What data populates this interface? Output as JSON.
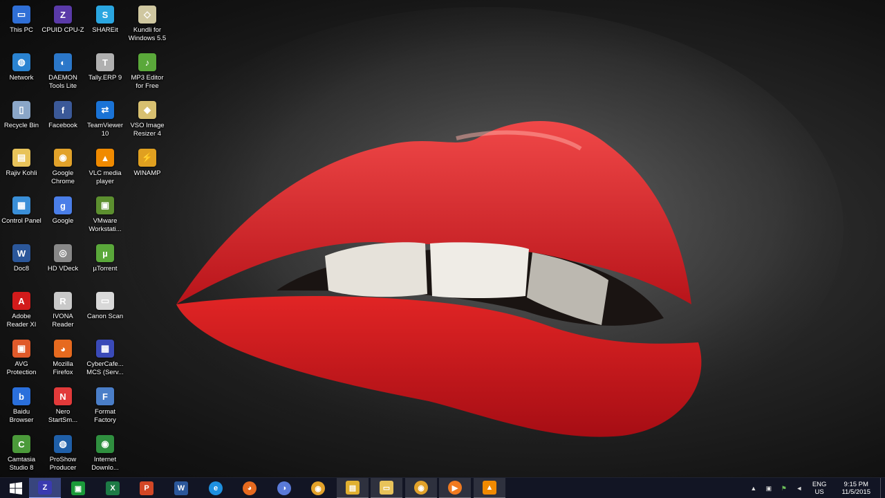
{
  "desktop": {
    "icons": [
      {
        "label": "This PC",
        "icon": "computer-icon",
        "color": "#2f6fd6",
        "glyph": "▭"
      },
      {
        "label": "Network",
        "icon": "network-globe-icon",
        "color": "#2a83d1",
        "glyph": "◍"
      },
      {
        "label": "Recycle Bin",
        "icon": "recycle-bin-icon",
        "color": "#8aa6c8",
        "glyph": "▯"
      },
      {
        "label": "Rajiv Kohli",
        "icon": "user-folder-icon",
        "color": "#e8c35a",
        "glyph": "▤"
      },
      {
        "label": "Control Panel",
        "icon": "control-panel-icon",
        "color": "#3a8fd8",
        "glyph": "▦"
      },
      {
        "label": "Doc8",
        "icon": "word-document-icon",
        "color": "#2b579a",
        "glyph": "W"
      },
      {
        "label": "Adobe\nReader XI",
        "icon": "adobe-reader-icon",
        "color": "#d21b1b",
        "glyph": "A"
      },
      {
        "label": "AVG\nProtection",
        "icon": "avg-icon",
        "color": "#e05a2a",
        "glyph": "▣"
      },
      {
        "label": "Baidu\nBrowser",
        "icon": "baidu-browser-icon",
        "color": "#2a6fdb",
        "glyph": "b"
      },
      {
        "label": "Camtasia\nStudio 8",
        "icon": "camtasia-icon",
        "color": "#4b9a3a",
        "glyph": "C"
      },
      {
        "label": "CPUID CPU-Z",
        "icon": "cpu-z-icon",
        "color": "#5a3aa8",
        "glyph": "Z"
      },
      {
        "label": "DAEMON\nTools Lite",
        "icon": "daemon-tools-icon",
        "color": "#2b77c9",
        "glyph": "◐"
      },
      {
        "label": "Facebook",
        "icon": "facebook-icon",
        "color": "#3b5998",
        "glyph": "f"
      },
      {
        "label": "Google\nChrome",
        "icon": "chrome-icon",
        "color": "#e2a22a",
        "glyph": "◉"
      },
      {
        "label": "Google",
        "icon": "google-icon",
        "color": "#4a7ee8",
        "glyph": "g"
      },
      {
        "label": "HD VDeck",
        "icon": "hd-vdeck-icon",
        "color": "#888888",
        "glyph": "◎"
      },
      {
        "label": "IVONA\nReader",
        "icon": "ivona-reader-icon",
        "color": "#c9c9c9",
        "glyph": "R"
      },
      {
        "label": "Mozilla\nFirefox",
        "icon": "firefox-icon",
        "color": "#e66a1f",
        "glyph": "◕"
      },
      {
        "label": "Nero\nStartSm...",
        "icon": "nero-icon",
        "color": "#e23a3a",
        "glyph": "N"
      },
      {
        "label": "ProShow\nProducer",
        "icon": "proshow-icon",
        "color": "#1f5fa8",
        "glyph": "◍"
      },
      {
        "label": "SHAREit",
        "icon": "shareit-icon",
        "color": "#2aa6e0",
        "glyph": "S"
      },
      {
        "label": "Tally.ERP 9",
        "icon": "tally-icon",
        "color": "#b0b0b0",
        "glyph": "T"
      },
      {
        "label": "TeamViewer\n10",
        "icon": "teamviewer-icon",
        "color": "#1a73d6",
        "glyph": "⇄"
      },
      {
        "label": "VLC media\nplayer",
        "icon": "vlc-icon",
        "color": "#f08a00",
        "glyph": "▲"
      },
      {
        "label": "VMware\nWorkstati...",
        "icon": "vmware-icon",
        "color": "#5c8f2f",
        "glyph": "▣"
      },
      {
        "label": "µTorrent",
        "icon": "utorrent-icon",
        "color": "#5aa83a",
        "glyph": "µ"
      },
      {
        "label": "Canon Scan",
        "icon": "canon-scan-icon",
        "color": "#d8d8d8",
        "glyph": "▭"
      },
      {
        "label": "CyberCafe...\nMCS (Serv...",
        "icon": "cybercafe-icon",
        "color": "#3a4ab8",
        "glyph": "▦"
      },
      {
        "label": "Format\nFactory",
        "icon": "format-factory-icon",
        "color": "#4a7ec8",
        "glyph": "F"
      },
      {
        "label": "Internet\nDownlo...",
        "icon": "internet-download-manager-icon",
        "color": "#2f8f3f",
        "glyph": "◉"
      },
      {
        "label": "Kundli for\nWindows 5.5",
        "icon": "kundli-icon",
        "color": "#cfc7a0",
        "glyph": "◇"
      },
      {
        "label": "MP3 Editor\nfor Free",
        "icon": "mp3-editor-icon",
        "color": "#5aa83a",
        "glyph": "♪"
      },
      {
        "label": "VSO Image\nResizer 4",
        "icon": "vso-image-resizer-icon",
        "color": "#d8c070",
        "glyph": "◆"
      },
      {
        "label": "WINAMP",
        "icon": "winamp-icon",
        "color": "#e0a020",
        "glyph": "⚡"
      }
    ]
  },
  "taskbar": {
    "start": {
      "icon": "windows-start-icon",
      "color": "#ffffff"
    },
    "apps": [
      {
        "name": "CPU-Z (running)",
        "icon": "cpu-z-taskbar-icon",
        "color": "#3a3ab0",
        "glyph": "Z",
        "state": "active"
      },
      {
        "name": "Store",
        "icon": "store-icon",
        "color": "#1b9a3a",
        "glyph": "▣",
        "state": ""
      },
      {
        "name": "Excel",
        "icon": "excel-icon",
        "color": "#1d7a45",
        "glyph": "X",
        "state": ""
      },
      {
        "name": "PowerPoint",
        "icon": "powerpoint-icon",
        "color": "#d24726",
        "glyph": "P",
        "state": ""
      },
      {
        "name": "Word",
        "icon": "word-icon",
        "color": "#2b579a",
        "glyph": "W",
        "state": ""
      },
      {
        "name": "Internet Explorer",
        "icon": "internet-explorer-icon",
        "color": "#1e90e0",
        "glyph": "e",
        "state": ""
      },
      {
        "name": "Firefox",
        "icon": "firefox-taskbar-icon",
        "color": "#e66a1f",
        "glyph": "◕",
        "state": ""
      },
      {
        "name": "Baidu",
        "icon": "baidu-taskbar-icon",
        "color": "#5a7ad8",
        "glyph": "◑",
        "state": ""
      },
      {
        "name": "Chrome",
        "icon": "chrome-taskbar-icon",
        "color": "#e2a22a",
        "glyph": "◉",
        "state": ""
      },
      {
        "name": "Folder",
        "icon": "folder-taskbar-icon",
        "color": "#e0b030",
        "glyph": "▤",
        "state": "pinned-open"
      },
      {
        "name": "File Explorer",
        "icon": "file-explorer-icon",
        "color": "#e8c35a",
        "glyph": "▭",
        "state": "pinned-open"
      },
      {
        "name": "Chrome Window",
        "icon": "chrome-window-icon",
        "color": "#e2a22a",
        "glyph": "◉",
        "state": "pinned-open"
      },
      {
        "name": "Media Player",
        "icon": "media-player-icon",
        "color": "#f07a20",
        "glyph": "▶",
        "state": "pinned-open"
      },
      {
        "name": "VLC",
        "icon": "vlc-taskbar-icon",
        "color": "#f08a00",
        "glyph": "▲",
        "state": "pinned-open"
      }
    ]
  },
  "tray": {
    "language_top": "ENG",
    "language_bottom": "US",
    "time": "9:15 PM",
    "date": "11/5/2015"
  }
}
